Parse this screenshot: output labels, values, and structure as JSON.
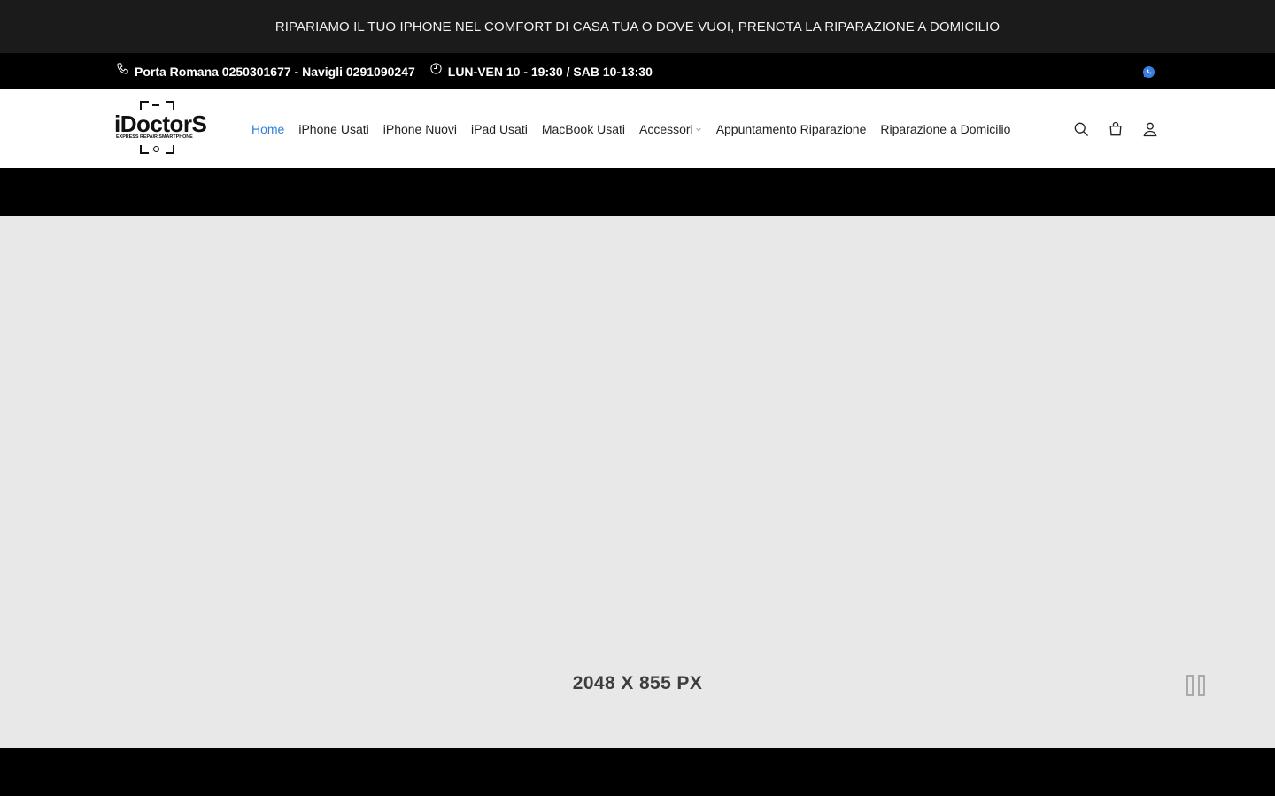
{
  "announcement": "RIPARIAMO IL TUO IPHONE NEL COMFORT DI CASA TUA O DOVE VUOI, PRENOTA LA RIPARAZIONE A DOMICILIO",
  "topbar": {
    "phone_icon": "phone-icon",
    "phones": "Porta Romana 0250301677 - Navigli 0291090247",
    "clock_icon": "clock-icon",
    "hours": "LUN-VEN 10 - 19:30 / SAB 10-13:30",
    "whatsapp_icon": "whatsapp-icon",
    "whatsapp_color": "#3b7de0"
  },
  "header": {
    "logo": {
      "name": "iDoctorS",
      "tagline": "EXPRESS REPAIR SMARTPHONE"
    },
    "nav": [
      {
        "label": "Home",
        "active": true
      },
      {
        "label": "iPhone Usati"
      },
      {
        "label": "iPhone Nuovi"
      },
      {
        "label": "iPad Usati"
      },
      {
        "label": "MacBook Usati"
      },
      {
        "label": "Accessori",
        "has_dropdown": true
      },
      {
        "label": "Appuntamento Riparazione"
      },
      {
        "label": "Riparazione a Domicilio"
      }
    ],
    "icons": [
      "search-icon",
      "cart-icon",
      "account-icon"
    ],
    "active_color": "#2f7fd8"
  },
  "hero": {
    "placeholder_text": "2048 X 855 PX",
    "pause_icon": "pause-icon",
    "background": "#e8e8e8"
  }
}
